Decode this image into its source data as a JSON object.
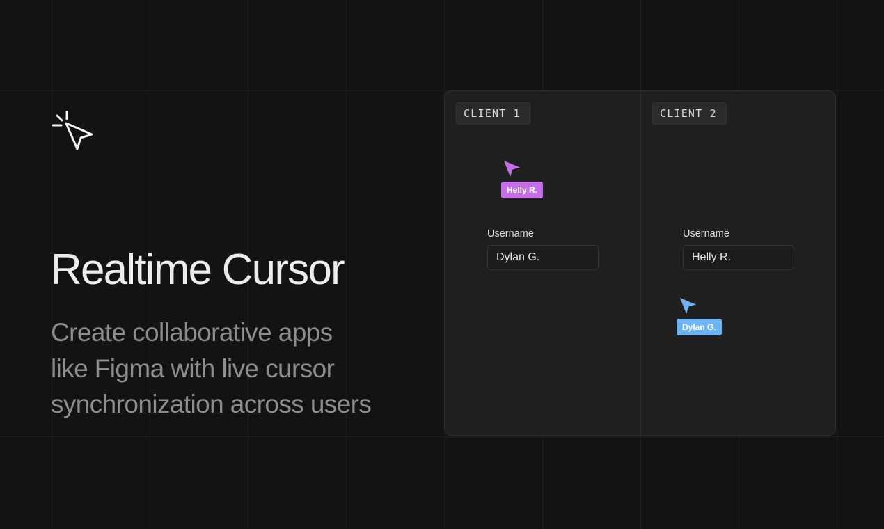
{
  "hero": {
    "icon": "pointer-click-icon",
    "title": "Realtime Cursor",
    "subtitle_lines": [
      "Create collaborative apps",
      "like Figma with live cursor",
      "synchronization across users"
    ]
  },
  "clients": [
    {
      "tag": "CLIENT 1",
      "field_label": "Username",
      "field_value": "Dylan G.",
      "remote_cursor": {
        "name": "Helly R.",
        "color": "#c66ee8",
        "icon": "cursor-arrow-icon"
      }
    },
    {
      "tag": "CLIENT 2",
      "field_label": "Username",
      "field_value": "Helly R.",
      "remote_cursor": {
        "name": "Dylan G.",
        "color": "#6fb2f2",
        "icon": "cursor-arrow-icon"
      }
    }
  ],
  "colors": {
    "background": "#131313",
    "panel": "#1f1f1f",
    "grid_line": "#1f1f1f",
    "subtitle": "#8d8d8d"
  }
}
